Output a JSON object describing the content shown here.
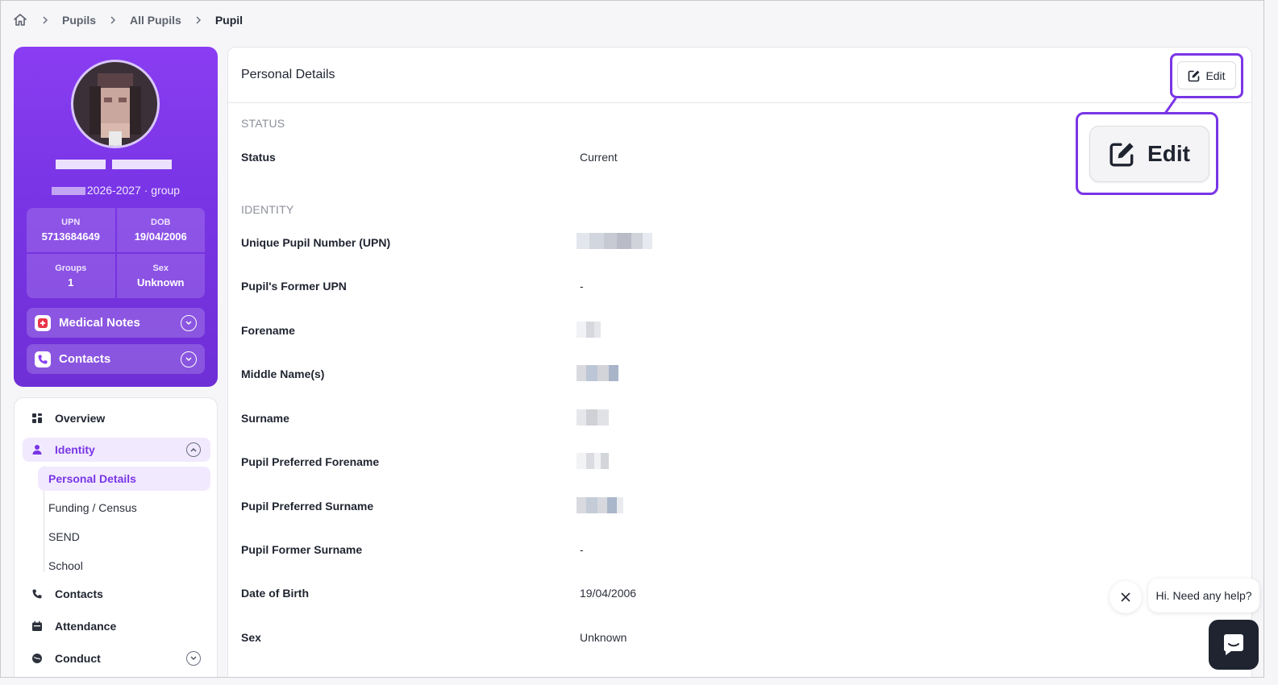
{
  "breadcrumb": {
    "items": [
      "Pupils",
      "All Pupils",
      "Pupil"
    ]
  },
  "profile": {
    "group_line": "2026-2027 · group",
    "stats": [
      {
        "label": "UPN",
        "value": "5713684649"
      },
      {
        "label": "DOB",
        "value": "19/04/2006"
      },
      {
        "label": "Groups",
        "value": "1"
      },
      {
        "label": "Sex",
        "value": "Unknown"
      }
    ],
    "medical_notes_label": "Medical Notes",
    "contacts_label": "Contacts"
  },
  "nav": {
    "overview": "Overview",
    "identity": "Identity",
    "sub": [
      "Personal Details",
      "Funding / Census",
      "SEND",
      "School"
    ],
    "contacts": "Contacts",
    "attendance": "Attendance",
    "conduct": "Conduct"
  },
  "panel": {
    "title": "Personal Details",
    "edit_label": "Edit",
    "status_section": "STATUS",
    "identity_section": "IDENTITY",
    "fields": [
      {
        "label": "Status",
        "value": "Current"
      },
      {
        "label": "Unique Pupil Number (UPN)",
        "value": ""
      },
      {
        "label": "Pupil's Former UPN",
        "value": "-"
      },
      {
        "label": "Forename",
        "value": ""
      },
      {
        "label": "Middle Name(s)",
        "value": ""
      },
      {
        "label": "Surname",
        "value": ""
      },
      {
        "label": "Pupil Preferred Forename",
        "value": ""
      },
      {
        "label": "Pupil Preferred Surname",
        "value": ""
      },
      {
        "label": "Pupil Former Surname",
        "value": "-"
      },
      {
        "label": "Date of Birth",
        "value": "19/04/2006"
      },
      {
        "label": "Sex",
        "value": "Unknown"
      }
    ]
  },
  "help": {
    "bubble": "Hi. Need any help?"
  },
  "colors": {
    "accent": "#7a35e6",
    "accent_light": "#f1eafe",
    "dark": "#1f2430"
  }
}
